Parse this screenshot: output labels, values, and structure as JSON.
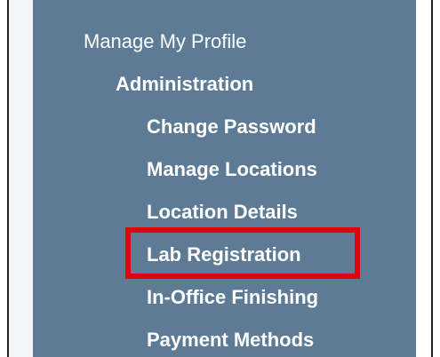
{
  "nav": {
    "manage_profile": "Manage My Profile",
    "administration": "Administration",
    "items": [
      {
        "label": "Change Password"
      },
      {
        "label": "Manage Locations"
      },
      {
        "label": "Location Details"
      },
      {
        "label": "Lab Registration",
        "highlighted": true
      },
      {
        "label": "In-Office Finishing"
      },
      {
        "label": "Payment Methods"
      }
    ]
  },
  "colors": {
    "panel_background": "#5e7b96",
    "left_strip": "#f3f5f8",
    "text": "#ffffff",
    "highlight_border": "#e3000f",
    "frame_border": "#222222"
  }
}
